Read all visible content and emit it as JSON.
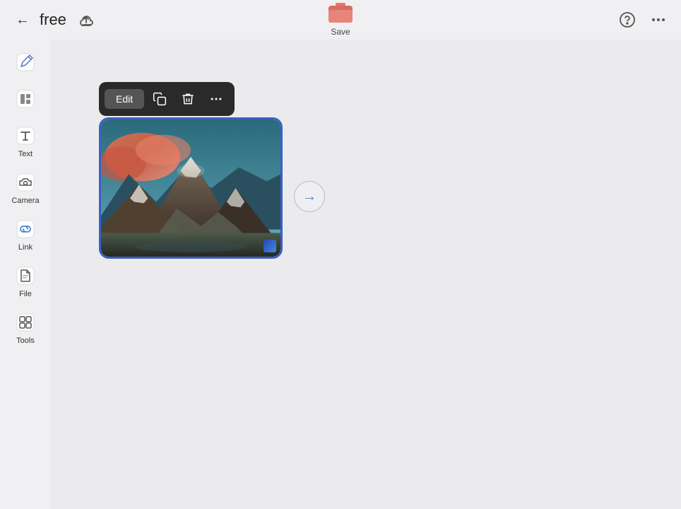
{
  "header": {
    "title": "free",
    "back_label": "←",
    "save_label": "Save"
  },
  "toolbar": {
    "edit_label": "Edit",
    "copy_icon": "copy-icon",
    "delete_icon": "delete-icon",
    "more_icon": "more-icon"
  },
  "sidebar": {
    "items": [
      {
        "id": "write",
        "label": ""
      },
      {
        "id": "layout",
        "label": ""
      },
      {
        "id": "text",
        "label": "Text"
      },
      {
        "id": "camera",
        "label": "Camera"
      },
      {
        "id": "link",
        "label": "Link"
      },
      {
        "id": "file",
        "label": "File"
      },
      {
        "id": "tools",
        "label": "Tools"
      }
    ]
  },
  "image": {
    "alt": "Mountain landscape with snow-capped peaks and orange clouds"
  }
}
